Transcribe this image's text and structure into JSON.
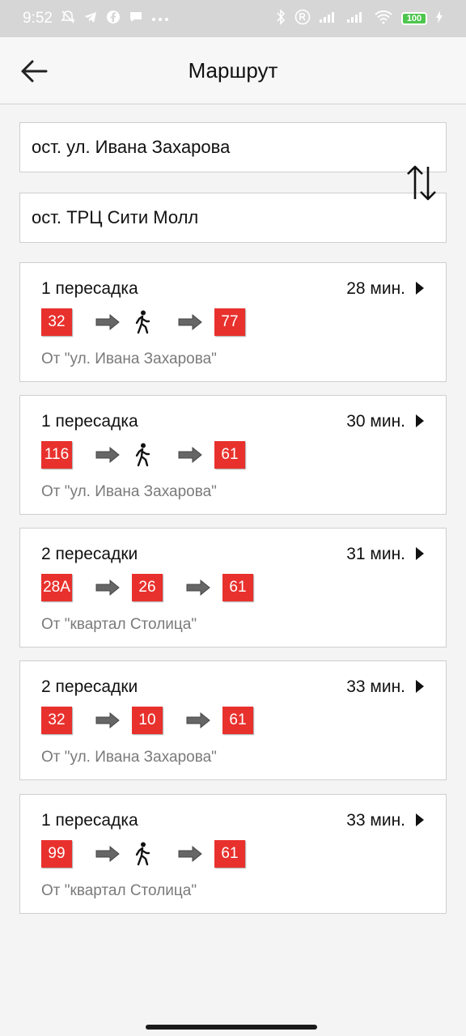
{
  "status_bar": {
    "time": "9:52",
    "battery": "100",
    "left_icons": [
      "muted-bell-icon",
      "telegram-icon",
      "facebook-icon",
      "chat-bubble-icon",
      "more-dots-icon"
    ],
    "right_icons": [
      "bluetooth-icon",
      "registered-icon",
      "signal-icon",
      "signal-icon",
      "wifi-icon",
      "battery-icon",
      "charging-icon"
    ]
  },
  "appbar": {
    "title": "Маршрут",
    "back_icon": "arrow-left-icon"
  },
  "search": {
    "from": "ост. ул. Ивана Захарова",
    "to": "ост. ТРЦ Сити Молл",
    "swap_icon": "swap-vertical-icon"
  },
  "routes": [
    {
      "transfers": "1 пересадка",
      "duration": "28 мин.",
      "from": "От \"ул. Ивана Захарова\"",
      "steps": [
        {
          "type": "route",
          "label": "32"
        },
        {
          "type": "arrow"
        },
        {
          "type": "walk"
        },
        {
          "type": "arrow"
        },
        {
          "type": "route",
          "label": "77"
        }
      ]
    },
    {
      "transfers": "1 пересадка",
      "duration": "30 мин.",
      "from": "От \"ул. Ивана Захарова\"",
      "steps": [
        {
          "type": "route",
          "label": "116"
        },
        {
          "type": "arrow"
        },
        {
          "type": "walk"
        },
        {
          "type": "arrow"
        },
        {
          "type": "route",
          "label": "61"
        }
      ]
    },
    {
      "transfers": "2 пересадки",
      "duration": "31 мин.",
      "from": "От \"квартал Столица\"",
      "steps": [
        {
          "type": "route",
          "label": "28А"
        },
        {
          "type": "arrow"
        },
        {
          "type": "route",
          "label": "26"
        },
        {
          "type": "arrow"
        },
        {
          "type": "route",
          "label": "61"
        }
      ]
    },
    {
      "transfers": "2 пересадки",
      "duration": "33 мин.",
      "from": "От \"ул. Ивана Захарова\"",
      "steps": [
        {
          "type": "route",
          "label": "32"
        },
        {
          "type": "arrow"
        },
        {
          "type": "route",
          "label": "10"
        },
        {
          "type": "arrow"
        },
        {
          "type": "route",
          "label": "61"
        }
      ]
    },
    {
      "transfers": "1 пересадка",
      "duration": "33 мин.",
      "from": "От \"квартал Столица\"",
      "steps": [
        {
          "type": "route",
          "label": "99"
        },
        {
          "type": "arrow"
        },
        {
          "type": "walk"
        },
        {
          "type": "arrow"
        },
        {
          "type": "route",
          "label": "61"
        }
      ]
    }
  ],
  "colors": {
    "route_badge": "#e8312d",
    "from_text": "#7a7a7a",
    "arrow": "#666666"
  }
}
